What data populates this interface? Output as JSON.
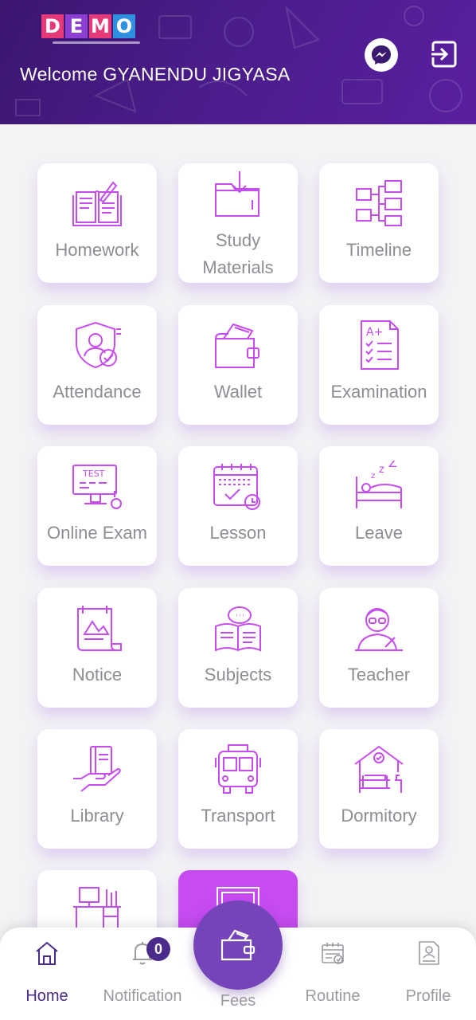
{
  "header": {
    "logo_letters": [
      "D",
      "E",
      "M",
      "O"
    ],
    "welcome_text": "Welcome GYANENDU JIGYASA",
    "messenger_icon": "messenger-icon",
    "logout_icon": "logout-icon"
  },
  "grid": {
    "tiles": [
      {
        "label": "Homework",
        "icon": "homework-icon"
      },
      {
        "label": "Study Materials",
        "icon": "study-materials-icon"
      },
      {
        "label": "Timeline",
        "icon": "timeline-icon"
      },
      {
        "label": "Attendance",
        "icon": "attendance-icon"
      },
      {
        "label": "Wallet",
        "icon": "wallet-icon"
      },
      {
        "label": "Examination",
        "icon": "examination-icon"
      },
      {
        "label": "Online Exam",
        "icon": "online-exam-icon"
      },
      {
        "label": "Lesson",
        "icon": "lesson-icon"
      },
      {
        "label": "Leave",
        "icon": "leave-icon"
      },
      {
        "label": "Notice",
        "icon": "notice-icon"
      },
      {
        "label": "Subjects",
        "icon": "subjects-icon"
      },
      {
        "label": "Teacher",
        "icon": "teacher-icon"
      },
      {
        "label": "Library",
        "icon": "library-icon"
      },
      {
        "label": "Transport",
        "icon": "transport-icon"
      },
      {
        "label": "Dormitory",
        "icon": "dormitory-icon"
      }
    ],
    "study_materials_line1": "Study",
    "study_materials_line2": "Materials"
  },
  "bottom_nav": {
    "items": [
      {
        "label": "Home",
        "icon": "home-icon"
      },
      {
        "label": "Notification",
        "icon": "bell-icon"
      },
      {
        "label": "Fees",
        "icon": "wallet-icon"
      },
      {
        "label": "Routine",
        "icon": "calendar-icon"
      },
      {
        "label": "Profile",
        "icon": "profile-card-icon"
      }
    ],
    "notification_count": "0"
  },
  "colors": {
    "accent": "#c64cf0",
    "icon": "#c64cf0",
    "header_start": "#3b1670",
    "header_end": "#5a1fa0",
    "nav_active": "#4a2a8a",
    "fab": "#7444b8"
  }
}
